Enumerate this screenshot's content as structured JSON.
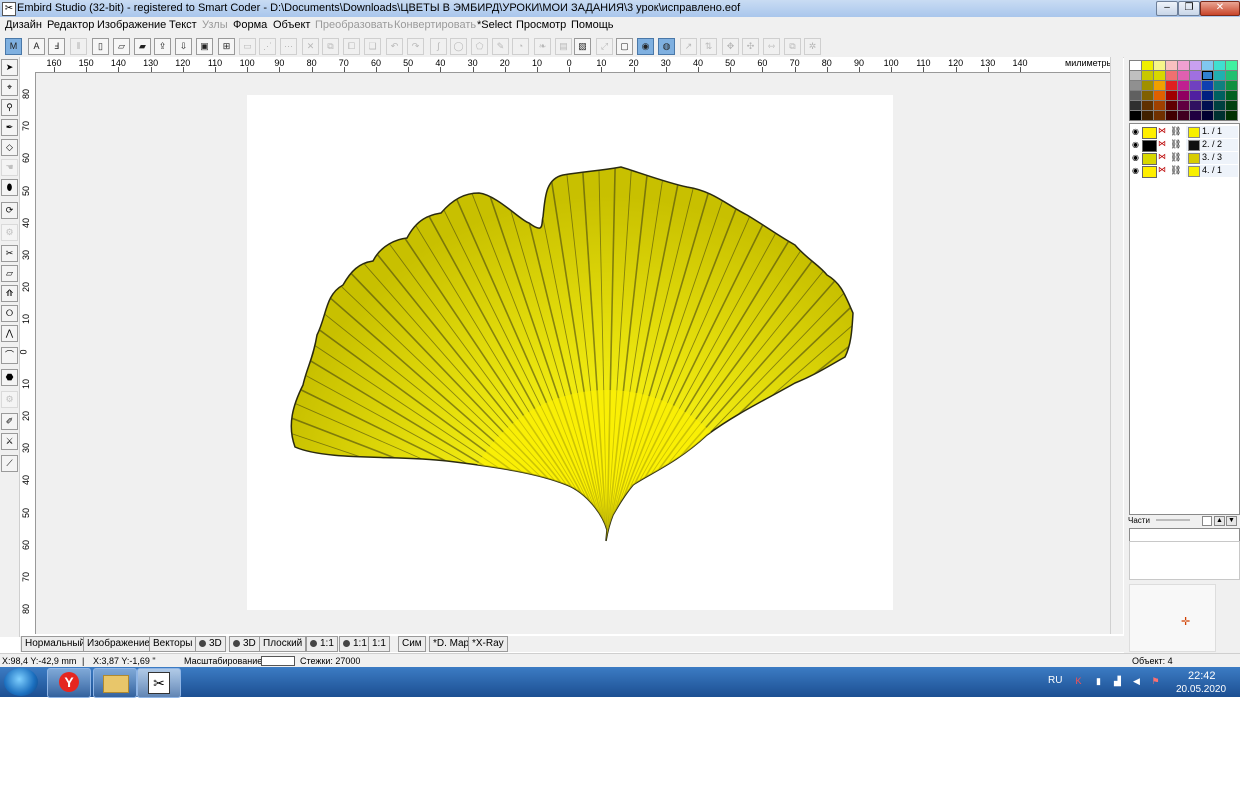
{
  "window": {
    "title": "Embird Studio (32-bit)  - registered to Smart Coder - D:\\Documents\\Downloads\\ЦВЕТЫ В ЭМБИРД\\УРОКИ\\МОИ ЗАДАНИЯ\\3 урок\\исправлено.eof",
    "min_glyph": "–",
    "max_glyph": "❐",
    "close_glyph": "✕"
  },
  "menu": [
    {
      "label": "Дизайн",
      "enabled": true
    },
    {
      "label": "Редактор",
      "enabled": true
    },
    {
      "label": "Изображение",
      "enabled": true
    },
    {
      "label": "Текст",
      "enabled": true
    },
    {
      "label": "Узлы",
      "enabled": false
    },
    {
      "label": "Форма",
      "enabled": true
    },
    {
      "label": "Объект",
      "enabled": true
    },
    {
      "label": "Преобразовать",
      "enabled": false
    },
    {
      "label": "Конвертировать",
      "enabled": false
    },
    {
      "label": "*Select",
      "enabled": true
    },
    {
      "label": "Просмотр",
      "enabled": true
    },
    {
      "label": "Помощь",
      "enabled": true
    }
  ],
  "ruler": {
    "h_labels": [
      "160",
      "150",
      "140",
      "130",
      "120",
      "110",
      "100",
      "90",
      "80",
      "70",
      "60",
      "50",
      "40",
      "30",
      "20",
      "10",
      "0",
      "10",
      "20",
      "30",
      "40",
      "50",
      "60",
      "70",
      "80",
      "90",
      "100",
      "110",
      "120",
      "130",
      "140"
    ],
    "unit": "милиметры",
    "v_labels": [
      "80",
      "70",
      "60",
      "50",
      "40",
      "30",
      "20",
      "10",
      "0",
      "10",
      "20",
      "30",
      "40",
      "50",
      "60",
      "70",
      "80"
    ]
  },
  "palette": {
    "colors": [
      "#ffffff",
      "#f0f000",
      "#f6f68a",
      "#f8c0c0",
      "#f0a0d0",
      "#c8a0f0",
      "#80c8f0",
      "#40e0d0",
      "#40f0a0",
      "#c0c0c0",
      "#c8c800",
      "#d8d800",
      "#f07070",
      "#e060b0",
      "#a070e0",
      "#3080d0",
      "#20b0b0",
      "#20c070",
      "#909090",
      "#a09000",
      "#f0a000",
      "#e02020",
      "#c02090",
      "#7040c0",
      "#1040b0",
      "#108080",
      "#109040",
      "#606060",
      "#806000",
      "#e06000",
      "#a00000",
      "#900060",
      "#5020a0",
      "#002080",
      "#006060",
      "#006020",
      "#303030",
      "#603000",
      "#a04000",
      "#600000",
      "#600040",
      "#301060",
      "#001050",
      "#004040",
      "#004010",
      "#000000",
      "#402000",
      "#703000",
      "#400000",
      "#400020",
      "#200040",
      "#000030",
      "#003030",
      "#003000"
    ],
    "selected_index": 15
  },
  "objects": [
    {
      "label": "1.  / 1",
      "color": "#f8f000",
      "thumb": "#ffef00"
    },
    {
      "label": "2.  / 2",
      "color": "#101010",
      "thumb": "#000000"
    },
    {
      "label": "3.  / 3",
      "color": "#d8cc00",
      "thumb": "#d8d800"
    },
    {
      "label": "4.  / 1",
      "color": "#f8f000",
      "thumb": "#ffef00"
    }
  ],
  "parts_label": "Части",
  "view_tabs": [
    {
      "label": "Нормальный"
    },
    {
      "label": "Изображение"
    },
    {
      "label": "Векторы"
    },
    {
      "label": "3D",
      "dot": true
    },
    {
      "label": "3D",
      "dot": true
    },
    {
      "label": "Плоский"
    },
    {
      "label": "1:1",
      "dot": true
    },
    {
      "label": "1:1",
      "dot": true
    },
    {
      "label": "1:1"
    },
    {
      "label": "Сим"
    },
    {
      "label": "*D. Map"
    },
    {
      "label": "*X-Ray"
    }
  ],
  "status": {
    "coords": "X:98,4  Y:-42,9 mm",
    "sep": "|",
    "coords2": "X:3,87  Y:-1,69 \"",
    "zoom_label": "Масштабирование: (",
    "stitches": "Стежки: 27000",
    "objects": "Объект: 4"
  },
  "taskbar": {
    "lang": "RU",
    "time": "22:42",
    "date": "20.05.2020"
  },
  "colors": {
    "leaf_light": "#fff200",
    "leaf_dark": "#3a3a10",
    "stroke": "#1a1a1a"
  }
}
